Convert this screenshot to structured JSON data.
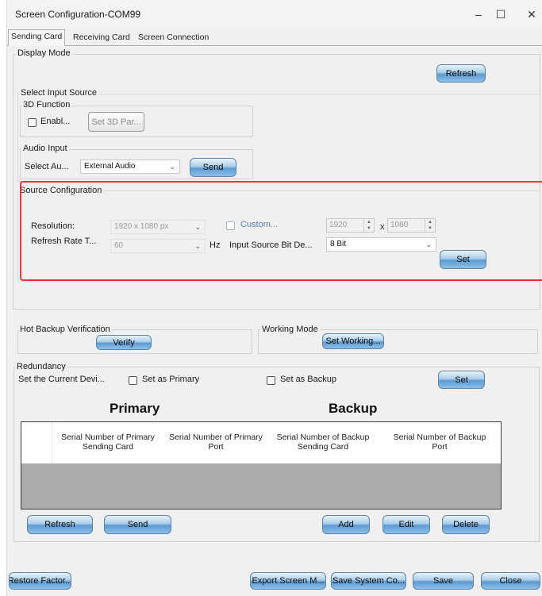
{
  "window": {
    "title": "Screen Configuration-COM99",
    "minimize": "–",
    "maximize": "☐",
    "close": "✕"
  },
  "tabs": [
    "Sending Card",
    "Receiving Card",
    "Screen Connection"
  ],
  "display_mode": {
    "label": "Display Mode",
    "refresh": "Refresh"
  },
  "input_source": {
    "label": "Select Input Source",
    "function_3d": {
      "label": "3D Function",
      "enable": "Enabl...",
      "set_params": "Set 3D Par..."
    },
    "audio": {
      "label": "Audio Input",
      "select_label": "Select Au...",
      "value": "External Audio",
      "send": "Send"
    }
  },
  "source_config": {
    "label": "Source Configuration",
    "resolution_label": "Resolution:",
    "resolution_value": "1920 x 1080 px",
    "custom_label": "Custom...",
    "width": "1920",
    "x": "x",
    "height": "1080",
    "refresh_label": "Refresh Rate T...",
    "refresh_value": "60",
    "hz": "Hz",
    "bit_depth_label": "Input Source Bit De...",
    "bit_depth_value": "8 Bit",
    "set": "Set"
  },
  "hot_backup": {
    "label": "Hot Backup Verification",
    "verify": "Verify"
  },
  "working_mode": {
    "label": "Working Mode",
    "set_working": "Set Working..."
  },
  "redundancy": {
    "label": "Redundancy",
    "current_device_label": "Set the Current Devi...",
    "primary_cb": "Set as Primary",
    "backup_cb": "Set as Backup",
    "set": "Set",
    "primary_heading": "Primary",
    "backup_heading": "Backup",
    "columns": [
      "Serial Number of Primary Sending Card",
      "Serial Number of Primary Port",
      "Serial Number of Backup Sending Card",
      "Serial Number of Backup Port"
    ],
    "refresh": "Refresh",
    "send": "Send",
    "add": "Add",
    "edit": "Edit",
    "delete": "Delete"
  },
  "footer": {
    "restore": "Restore Factor...",
    "export": "Export Screen M...",
    "save_system": "Save System Co...",
    "save": "Save",
    "close": "Close"
  }
}
